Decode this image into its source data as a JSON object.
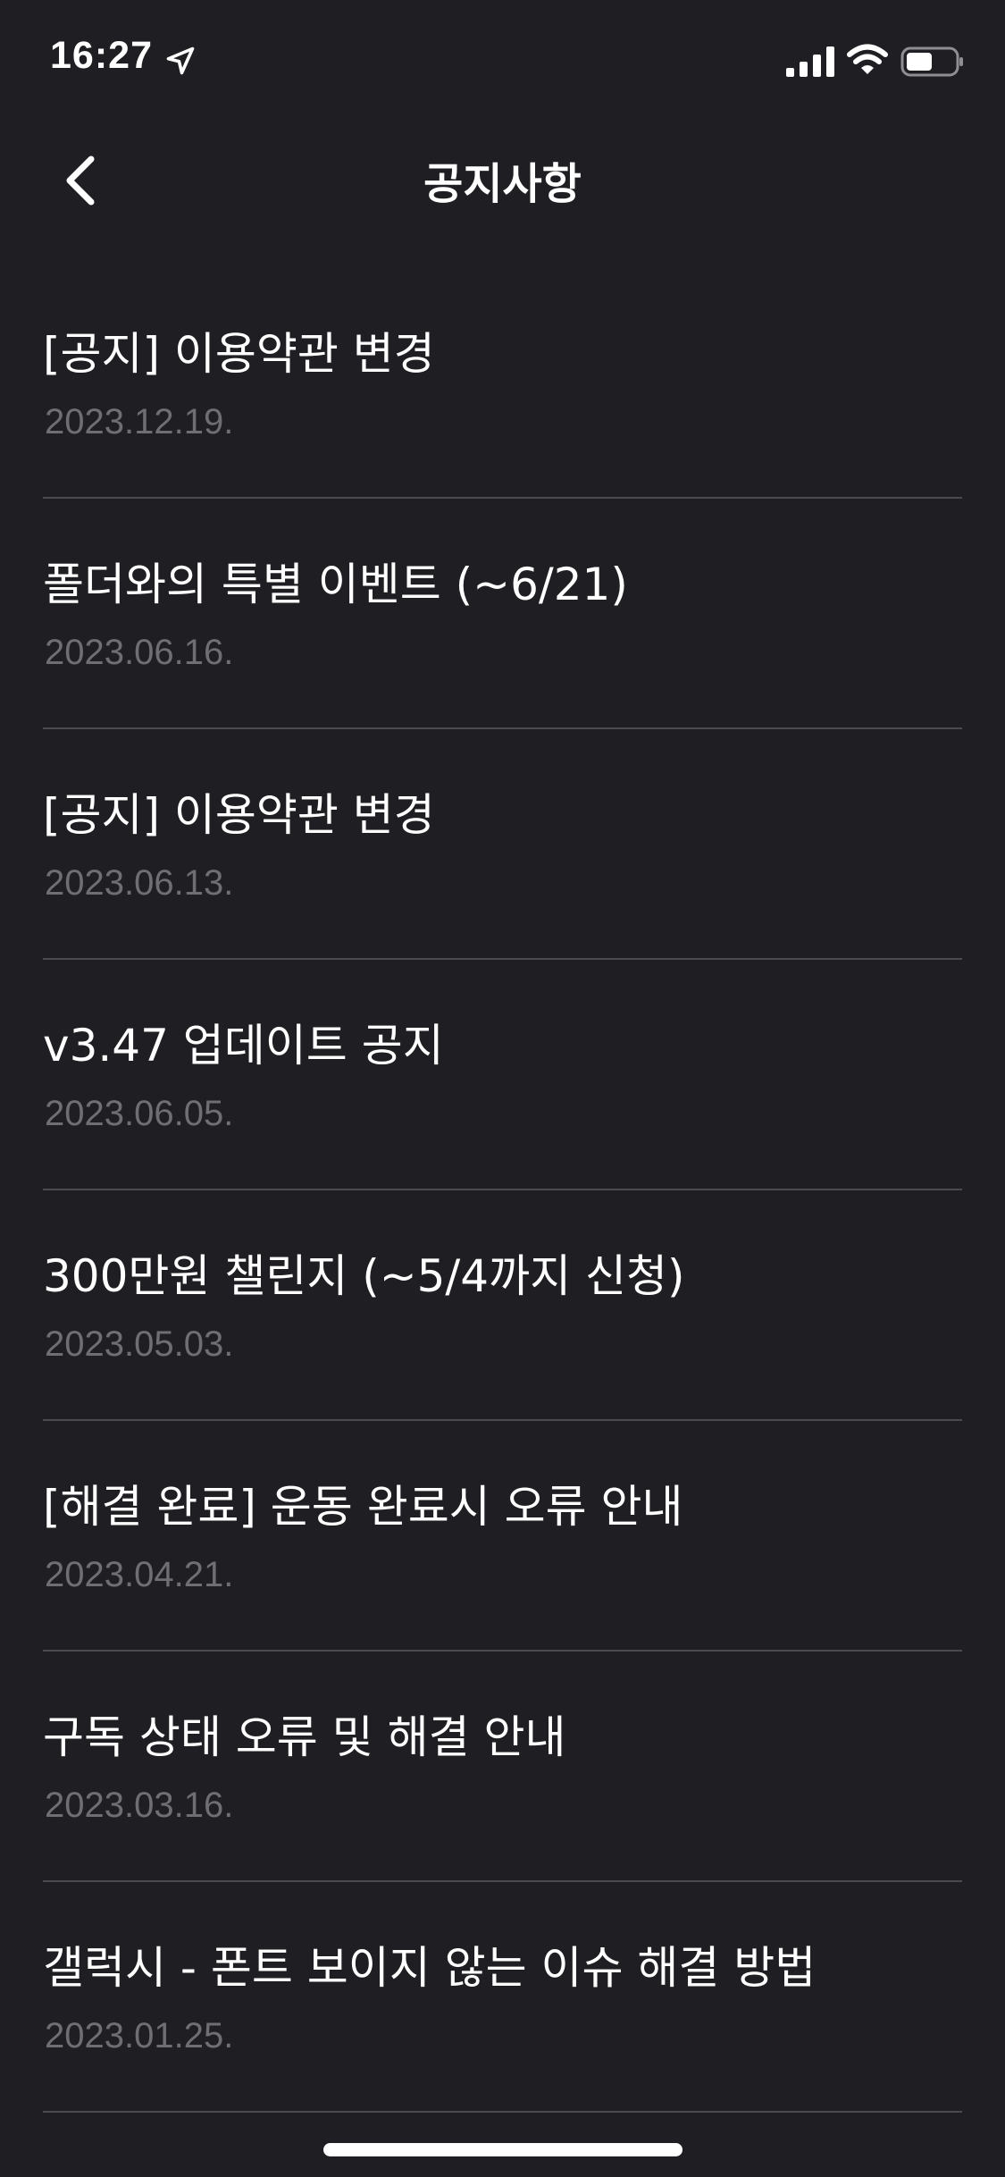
{
  "status_bar": {
    "time": "16:27",
    "icons": [
      "location-arrow-icon",
      "cellular-signal-icon",
      "wifi-icon",
      "battery-icon"
    ]
  },
  "header": {
    "back_icon": "chevron-left-icon",
    "title": "공지사항"
  },
  "notices": [
    {
      "title": "[공지] 이용약관 변경",
      "date": "2023.12.19."
    },
    {
      "title": "폴더와의 특별 이벤트 (~6/21)",
      "date": "2023.06.16."
    },
    {
      "title": "[공지] 이용약관 변경",
      "date": "2023.06.13."
    },
    {
      "title": "v3.47 업데이트 공지",
      "date": "2023.06.05."
    },
    {
      "title": "300만원 챌린지 (~5/4까지 신청)",
      "date": "2023.05.03."
    },
    {
      "title": "[해결 완료] 운동 완료시 오류 안내",
      "date": "2023.04.21."
    },
    {
      "title": "구독 상태 오류 및 해결 안내",
      "date": "2023.03.16."
    },
    {
      "title": "갤럭시 - 폰트 보이지 않는 이슈 해결 방법",
      "date": "2023.01.25."
    }
  ],
  "colors": {
    "background": "#1f1f23",
    "text_primary": "#ffffff",
    "text_secondary": "#6e6e73",
    "divider": "#4a4a4f"
  }
}
